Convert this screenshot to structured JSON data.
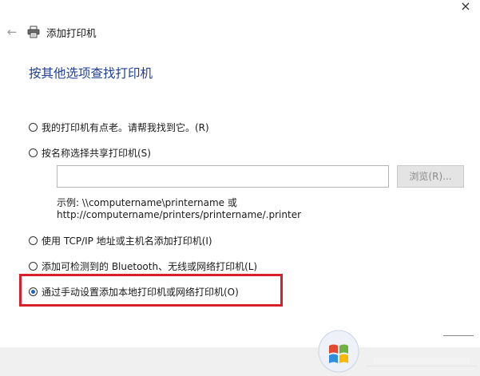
{
  "window": {
    "close_glyph": "×",
    "back_icon": "back-arrow-icon",
    "app_icon": "printer-icon",
    "title": "添加打印机"
  },
  "page": {
    "heading": "按其他选项查找打印机"
  },
  "options": [
    {
      "label": "我的打印机有点老。请帮我找到它。(R)",
      "selected": false
    },
    {
      "label": "按名称选择共享打印机(S)",
      "selected": false
    },
    {
      "label": "使用 TCP/IP 地址或主机名添加打印机(I)",
      "selected": false
    },
    {
      "label": "添加可检测到的 Bluetooth、无线或网络打印机(L)",
      "selected": false
    },
    {
      "label": "通过手动设置添加本地打印机或网络打印机(O)",
      "selected": true
    }
  ],
  "share": {
    "input_value": "",
    "browse_label": "浏览(R)...",
    "example_line1": "示例: \\\\computername\\printername 或",
    "example_line2": "http://computername/printers/printername/.printer"
  },
  "colors": {
    "heading": "#1e3f9a",
    "highlight": "#d6202a",
    "radio_selected": "#1e63c4"
  }
}
